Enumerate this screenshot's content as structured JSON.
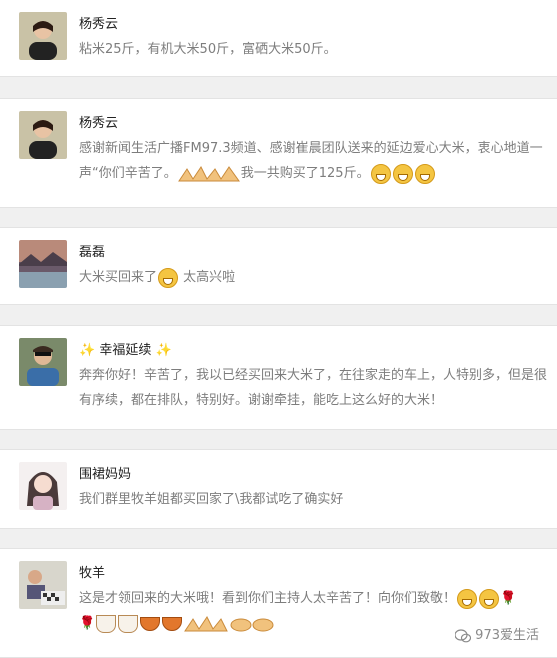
{
  "comments": [
    {
      "name": "杨秀云",
      "text": "粘米25斤，有机大米50斤，富硒大米50斤。"
    },
    {
      "name": "杨秀云",
      "text_a": "感谢新闻生活广播FM97.3频道、感谢崔晨团队送来的延边爱心大米，衷心地道一声“你们辛苦了。",
      "text_b": "我一共购买了125斤。"
    },
    {
      "name": "磊磊",
      "text_a": "大米买回来了",
      "text_b": "太高兴啦"
    },
    {
      "name": "幸福延续",
      "text": "奔奔你好！辛苦了，我以已经买回来大米了，在往家走的车上，人特别多，但是很有序续，都在排队，特别好。谢谢牵挂，能吃上这么好的大米！"
    },
    {
      "name": "围裙妈妈",
      "text": "我们群里牧羊姐都买回家了\\我都试吃了确实好"
    },
    {
      "name": "牧羊",
      "text": "这是才领回来的大米哦！看到你们主持人太辛苦了！向你们致敬！"
    }
  ],
  "watermark": "973爱生活",
  "icons": {
    "sparkle": "✨",
    "rose": "🌹"
  },
  "colors": {
    "name": "#222222",
    "text": "#7d7d7d",
    "background": "#f0f0f0",
    "card": "#ffffff"
  }
}
